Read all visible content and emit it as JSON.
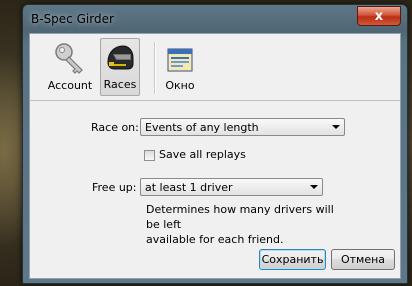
{
  "window": {
    "title": "B-Spec Girder",
    "close_glyph": "x"
  },
  "toolbar": {
    "items": [
      {
        "label": "Account",
        "icon": "key-icon"
      },
      {
        "label": "Races",
        "icon": "helmet-icon",
        "selected": true
      },
      {
        "label": "Окно",
        "icon": "window-settings-icon"
      }
    ]
  },
  "form": {
    "race_on_label": "Race on:",
    "race_on_value": "Events of any length",
    "save_replays_label": "Save all replays",
    "save_replays_checked": false,
    "free_up_label": "Free up:",
    "free_up_value": "at least 1 driver",
    "free_up_description_line1": "Determines how many drivers will be left",
    "free_up_description_line2": "available for each friend."
  },
  "buttons": {
    "save_label": "Сохранить",
    "cancel_label": "Отмена"
  }
}
